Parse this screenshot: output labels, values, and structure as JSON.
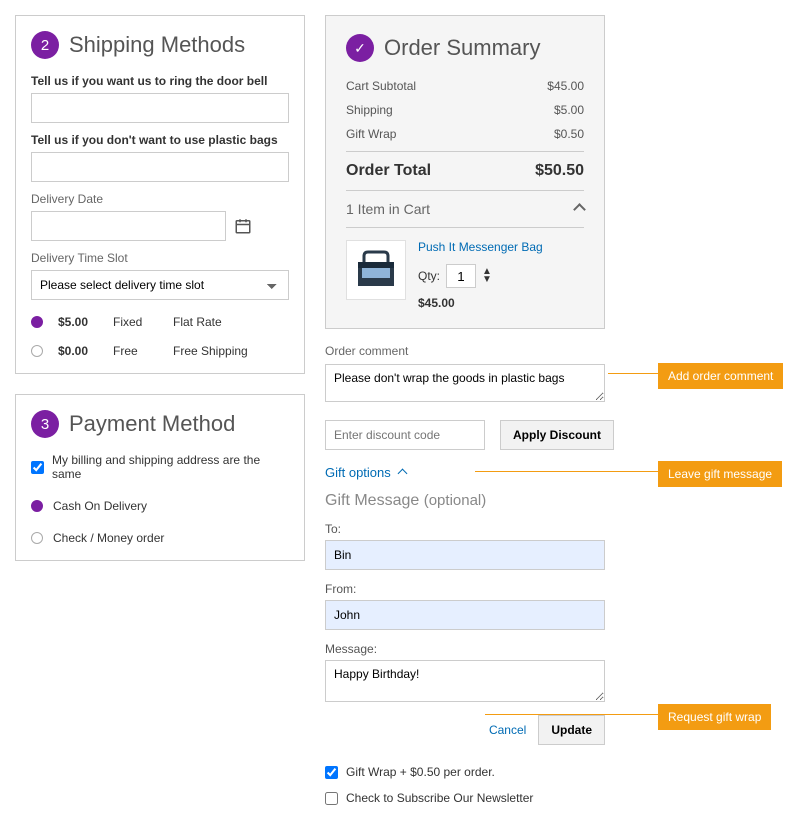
{
  "shipping": {
    "step": "2",
    "title": "Shipping Methods",
    "question1": "Tell us if you want us to ring the door bell",
    "question2": "Tell us if you don't want to use plastic bags",
    "delivery_date_label": "Delivery Date",
    "delivery_slot_label": "Delivery Time Slot",
    "slot_placeholder": "Please select delivery time slot",
    "options": [
      {
        "price": "$5.00",
        "type": "Fixed",
        "name": "Flat Rate",
        "selected": true
      },
      {
        "price": "$0.00",
        "type": "Free",
        "name": "Free Shipping",
        "selected": false
      }
    ]
  },
  "payment": {
    "step": "3",
    "title": "Payment Method",
    "same_address": "My billing and shipping address are the same",
    "same_checked": true,
    "options": [
      {
        "label": "Cash On Delivery",
        "selected": true
      },
      {
        "label": "Check / Money order",
        "selected": false
      }
    ]
  },
  "summary": {
    "title": "Order Summary",
    "lines": [
      {
        "label": "Cart Subtotal",
        "value": "$45.00"
      },
      {
        "label": "Shipping",
        "value": "$5.00"
      },
      {
        "label": "Gift Wrap",
        "value": "$0.50"
      }
    ],
    "total_label": "Order Total",
    "total_value": "$50.50",
    "cart_count": "1 Item in Cart",
    "item": {
      "name": "Push It Messenger Bag",
      "qty_label": "Qty:",
      "qty": "1",
      "price": "$45.00"
    }
  },
  "comment": {
    "label": "Order comment",
    "value": "Please don't wrap the goods in plastic bags"
  },
  "discount": {
    "placeholder": "Enter discount code",
    "button": "Apply Discount"
  },
  "gift": {
    "toggle": "Gift options",
    "header": "Gift Message",
    "optional": "(optional)",
    "to_label": "To:",
    "to_value": "Bin",
    "from_label": "From:",
    "from_value": "John",
    "msg_label": "Message:",
    "msg_value": "Happy Birthday!",
    "cancel": "Cancel",
    "update": "Update",
    "wrap_label": "Gift Wrap + $0.50 per order.",
    "newsletter": "Check to Subscribe Our Newsletter"
  },
  "callouts": {
    "comment": "Add order comment",
    "gift_msg": "Leave gift message",
    "gift_wrap": "Request gift wrap"
  }
}
